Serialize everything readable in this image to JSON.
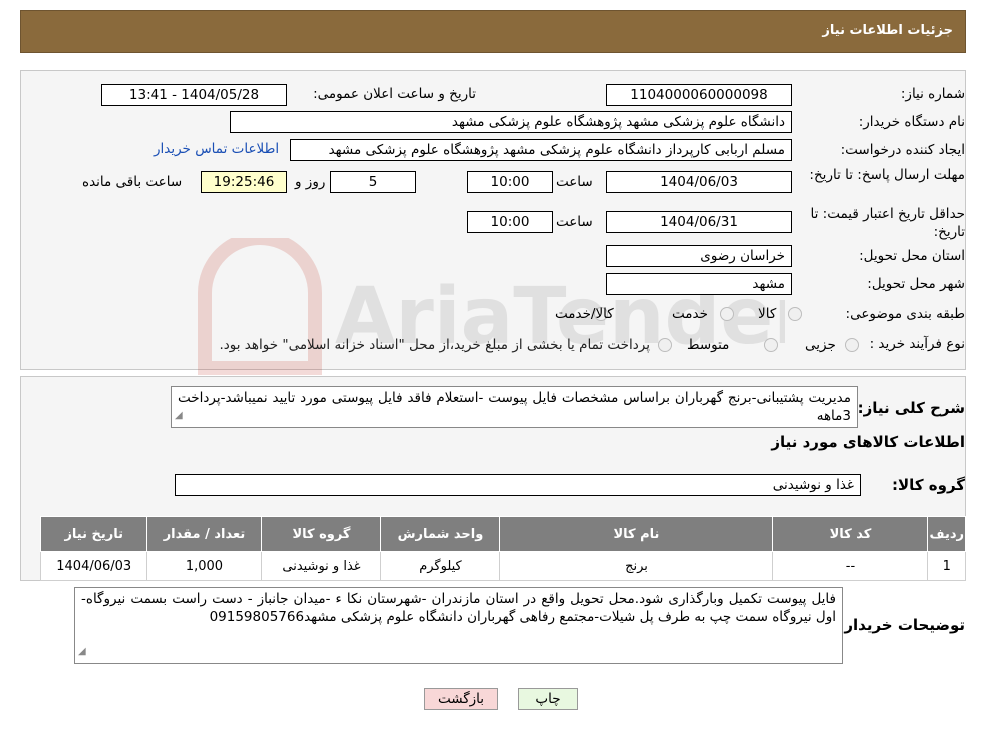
{
  "header": {
    "title": "جزئیات اطلاعات نیاز"
  },
  "form": {
    "need_number_label": "شماره نیاز:",
    "need_number": "1104000060000098",
    "announce_label": "تاریخ و ساعت اعلان عمومی:",
    "announce_value": "1404/05/28 - 13:41",
    "buyer_org_label": "نام دستگاه خریدار:",
    "buyer_org": "دانشگاه علوم پزشکی مشهد   پژوهشگاه علوم پزشکی مشهد",
    "creator_label": "ایجاد کننده درخواست:",
    "creator": "مسلم اربابی کارپرداز دانشگاه علوم پزشکی مشهد   پژوهشگاه علوم پزشکی مشهد",
    "contact_link": "اطلاعات تماس خریدار",
    "deadline_label": "مهلت ارسال پاسخ: تا تاریخ:",
    "deadline_date": "1404/06/03",
    "time_label": "ساعت",
    "deadline_time": "10:00",
    "days_value": "5",
    "days_label": "روز و",
    "remaining_time": "19:25:46",
    "remaining_label": "ساعت باقی مانده",
    "price_valid_label": "حداقل تاریخ اعتبار قیمت: تا تاریخ:",
    "price_valid_date": "1404/06/31",
    "price_valid_time": "10:00",
    "province_label": "استان محل تحویل:",
    "province": "خراسان رضوی",
    "city_label": "شهر محل تحویل:",
    "city": "مشهد",
    "category_label": "طبقه بندی موضوعی:",
    "category_options": [
      "کالا",
      "خدمت",
      "کالا/خدمت"
    ],
    "process_label": "نوع فرآیند خرید :",
    "process_options": [
      "جزیی",
      "متوسط"
    ],
    "process_note": "پرداخت تمام یا بخشی از مبلغ خرید،از محل \"اسناد خزانه اسلامی\" خواهد بود."
  },
  "description": {
    "label": "شرح کلی نیاز:",
    "text": "مدیریت پشتیبانی-برنج گهرباران براساس مشخصات فایل پیوست -استعلام فاقد فایل پیوستی مورد تایید نمیباشد-پرداخت 3ماهه"
  },
  "goods": {
    "section_title": "اطلاعات کالاهای مورد نیاز",
    "group_label": "گروه کالا:",
    "group_value": "غذا و نوشیدنی"
  },
  "table": {
    "headers": [
      "ردیف",
      "کد کالا",
      "نام کالا",
      "واحد شمارش",
      "گروه کالا",
      "تعداد / مقدار",
      "تاریخ نیاز"
    ],
    "rows": [
      [
        "1",
        "--",
        "برنج",
        "کیلوگرم",
        "غذا و نوشیدنی",
        "1,000",
        "1404/06/03"
      ]
    ]
  },
  "buyer_notes": {
    "label": "توضیحات خریدار:",
    "text": "فایل پیوست تکمیل وبارگذاری شود.محل تحویل واقع در استان مازندران -شهرستان نکا ء -میدان جانباز - دست راست بسمت نیروگاه-اول نیروگاه سمت چپ به طرف پل شیلات-مجتمع رفاهی گهرباران دانشگاه علوم پزشکی مشهد09159805766"
  },
  "buttons": {
    "print": "چاپ",
    "back": "بازگشت"
  },
  "watermark": {
    "text": "AriaTender.neT"
  },
  "colors": {
    "header_bg": "#8a6a3c",
    "table_header_bg": "#7f7f7f",
    "back_button_bg": "#f8d7d7",
    "print_button_bg": "#e8f8e0",
    "link": "#1a4fb5"
  }
}
